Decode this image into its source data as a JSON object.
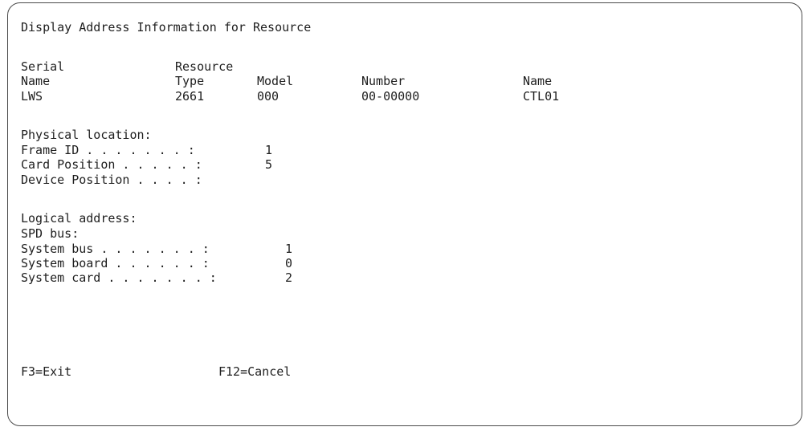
{
  "title": "Display Address Information for Resource",
  "header": {
    "row1": {
      "resource": "Resource",
      "serial": "Serial"
    },
    "row2": {
      "name": "Name",
      "type": "Type",
      "model": "Model",
      "number": "Number",
      "name2": "Name"
    }
  },
  "resource_row": {
    "name": "LWS",
    "type": "2661",
    "model": "000",
    "number": "00-00000",
    "resource_name": "CTL01"
  },
  "physical": {
    "heading": "Physical location:",
    "fields": [
      {
        "label": "Frame ID . . . . . . . :",
        "value": "1"
      },
      {
        "label": "Card Position . . . . . :",
        "value": "5"
      },
      {
        "label": "Device Position . . . . :",
        "value": ""
      }
    ]
  },
  "logical": {
    "heading": "Logical address:",
    "bus_heading": "SPD bus:",
    "fields": [
      {
        "label": "System bus . . . . . . . :",
        "value": "1"
      },
      {
        "label": "System board . . . . . . :",
        "value": "0"
      },
      {
        "label": "System card . . . . . . . :",
        "value": "2"
      }
    ]
  },
  "function_keys": {
    "exit": "F3=Exit",
    "cancel": "F12=Cancel"
  }
}
